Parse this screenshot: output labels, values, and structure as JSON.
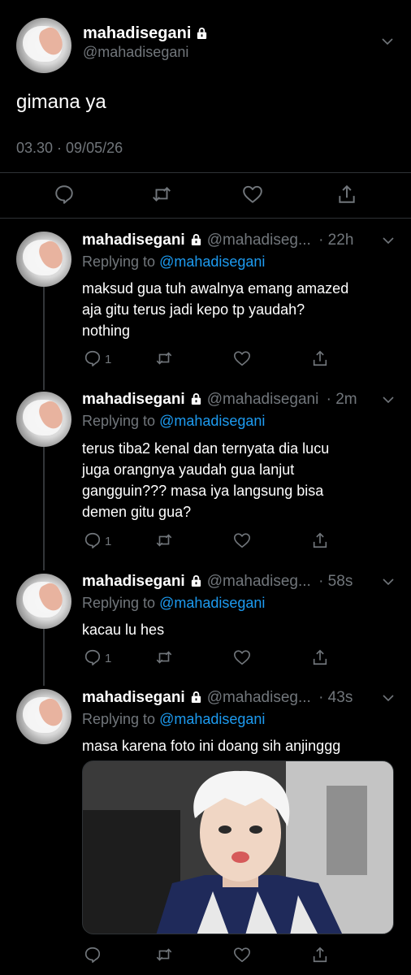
{
  "tweet": {
    "display_name": "mahadisegani",
    "handle": "@mahadisegani",
    "text": "gimana ya",
    "timestamp": "03.30 · 09/05/26"
  },
  "replies": [
    {
      "display_name": "mahadisegani",
      "handle": "@mahadiseg...",
      "age": "· 22h",
      "replying_prefix": "Replying to",
      "replying_to": "@mahadisegani",
      "lines": [
        "maksud gua tuh awalnya emang amazed",
        "aja gitu terus jadi kepo tp yaudah?",
        "nothing"
      ],
      "reply_count": "1"
    },
    {
      "display_name": "mahadisegani",
      "handle": "@mahadisegani",
      "age": "· 2m",
      "replying_prefix": "Replying to",
      "replying_to": "@mahadisegani",
      "lines": [
        "terus tiba2 kenal dan ternyata dia lucu",
        "juga orangnya yaudah gua lanjut",
        "gangguin??? masa iya langsung bisa",
        "demen gitu gua?"
      ],
      "reply_count": "1"
    },
    {
      "display_name": "mahadisegani",
      "handle": "@mahadiseg...",
      "age": "· 58s",
      "replying_prefix": "Replying to",
      "replying_to": "@mahadisegani",
      "lines": [
        "kacau lu hes"
      ],
      "reply_count": "1"
    },
    {
      "display_name": "mahadisegani",
      "handle": "@mahadiseg...",
      "age": "· 43s",
      "replying_prefix": "Replying to",
      "replying_to": "@mahadisegani",
      "lines": [
        "masa karena foto ini doang sih anjinggg"
      ],
      "reply_count": ""
    }
  ],
  "icons": {
    "lock": "lock-icon",
    "caret": "chevron-down-icon",
    "reply": "reply-icon",
    "retweet": "retweet-icon",
    "like": "heart-icon",
    "share": "share-icon"
  },
  "colors": {
    "background": "#000000",
    "text": "#ffffff",
    "muted": "#71767b",
    "mention": "#1d9bf0",
    "divider": "#2f3336"
  }
}
